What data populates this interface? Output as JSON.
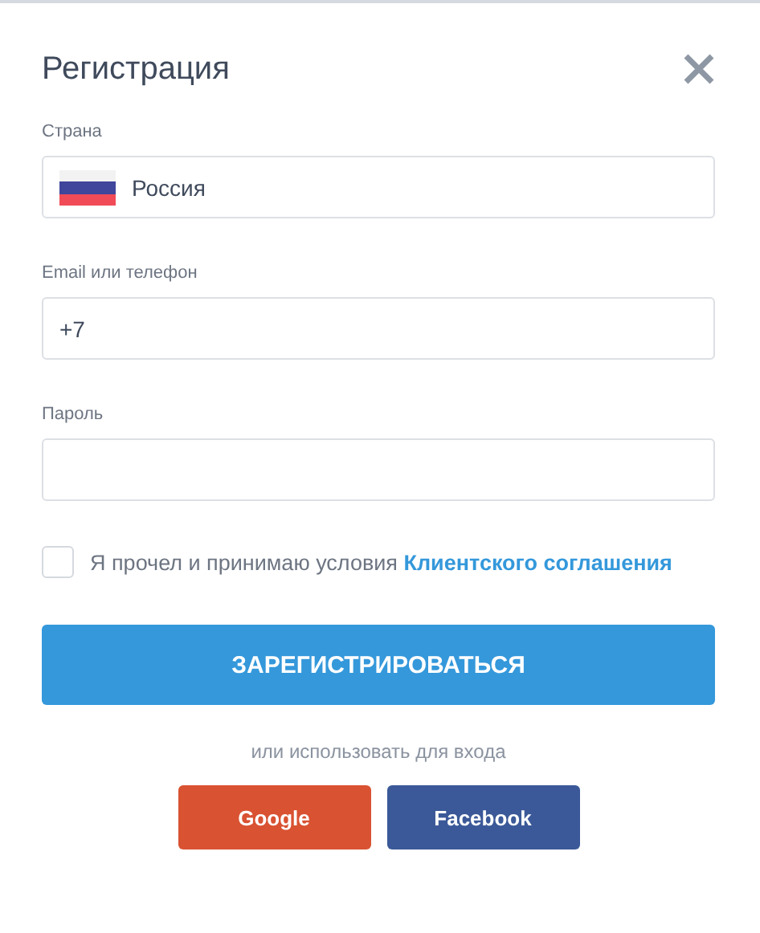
{
  "dialog": {
    "title": "Регистрация"
  },
  "fields": [
    {
      "kind": "country",
      "label": "Страна",
      "value": "Россия"
    },
    {
      "kind": "text",
      "label": "Email или телефон",
      "value": "+7"
    },
    {
      "kind": "password",
      "label": "Пароль"
    }
  ],
  "agreement": {
    "checked": false,
    "text": "Я прочел и принимаю условия",
    "link": "Клиентского соглашения"
  },
  "submit": "ЗАРЕГИСТРИРОВАТЬСЯ",
  "alt_login": "или использовать для входа",
  "social": [
    {
      "label": "Google",
      "color": "#d95232"
    },
    {
      "label": "Facebook",
      "color": "#3b5998"
    }
  ]
}
